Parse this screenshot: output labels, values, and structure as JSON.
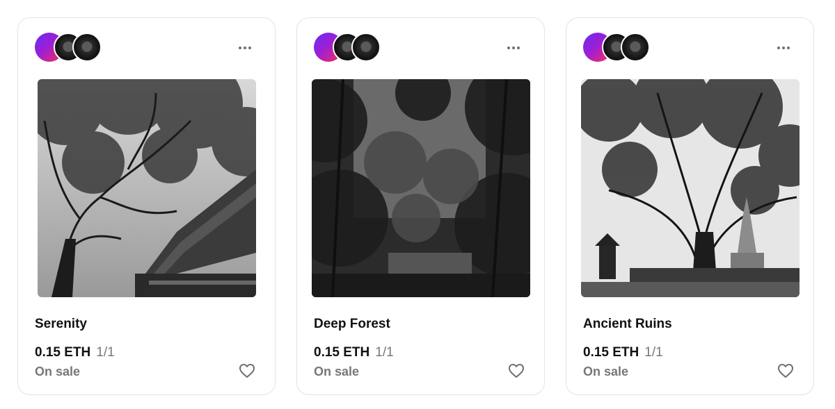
{
  "cards": [
    {
      "title": "Serenity",
      "price": "0.15 ETH",
      "edition": "1/1",
      "status": "On sale",
      "artwork": "black-and-white tree canopy over temple roof"
    },
    {
      "title": "Deep Forest",
      "price": "0.15 ETH",
      "edition": "1/1",
      "status": "On sale",
      "artwork": "black-and-white dense forest with pond"
    },
    {
      "title": "Ancient Ruins",
      "price": "0.15 ETH",
      "edition": "1/1",
      "status": "On sale",
      "artwork": "black-and-white large tree beside stupa ruins"
    }
  ],
  "icons": {
    "more": "more-horizontal-icon",
    "like": "heart-outline-icon"
  },
  "colors": {
    "avatar_gradient": [
      "#6a2cf0",
      "#ff2d55"
    ],
    "muted_text": "#777777",
    "card_border": "#e3e3e3"
  }
}
